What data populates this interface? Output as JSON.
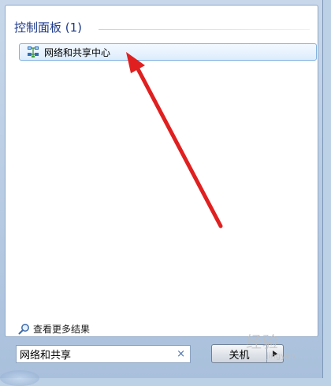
{
  "start_menu": {
    "group": {
      "title": "控制面板 (1)"
    },
    "results": [
      {
        "label": "网络和共享中心",
        "icon": "network-sharing-center-icon"
      }
    ],
    "see_more_label": "查看更多结果",
    "search": {
      "value": "网络和共享",
      "clear_glyph": "×"
    },
    "shutdown": {
      "label": "关机"
    }
  },
  "watermark": {
    "text": "经验",
    "sub": "jingyan"
  },
  "colors": {
    "header_text": "#1e3a8a",
    "highlight_border": "#7fb0e0",
    "arrow": "#e02020"
  }
}
